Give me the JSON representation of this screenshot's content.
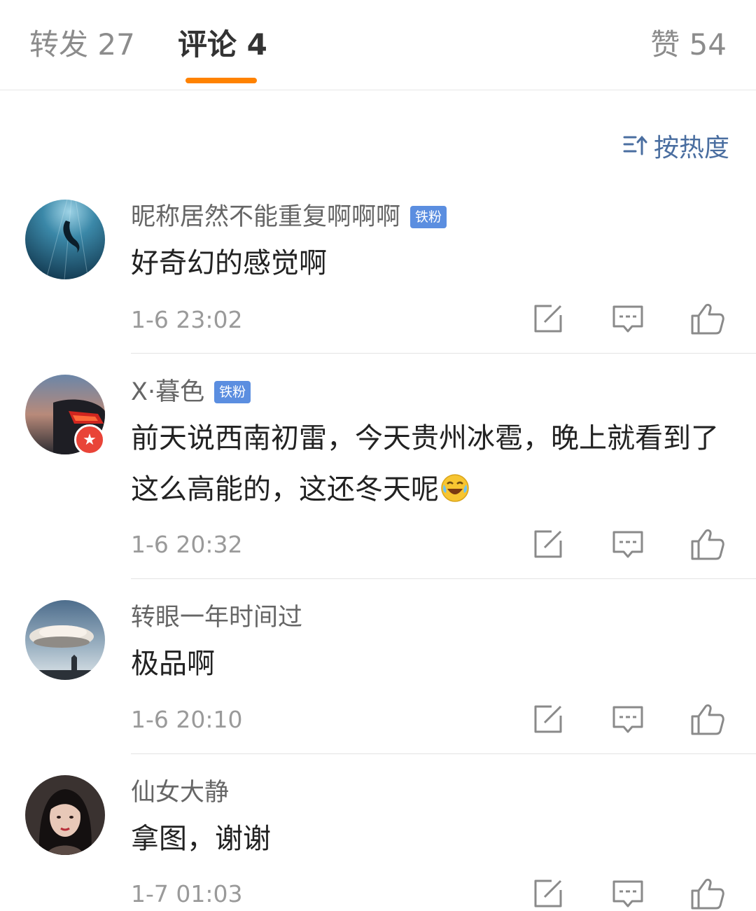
{
  "tabs": {
    "repost": "转发 27",
    "comment": "评论 4",
    "like": "赞 54"
  },
  "sort_label": "按热度",
  "colors": {
    "accent": "#ff8200",
    "link": "#4a6ea0",
    "badge": "#5b8ee0"
  },
  "comments": [
    {
      "name": "昵称居然不能重复啊啊啊",
      "badge": "铁粉",
      "text": "好奇幻的感觉啊",
      "time": "1-6 23:02"
    },
    {
      "name": "X·暮色",
      "badge": "铁粉",
      "text": "前天说西南初雷，今天贵州冰雹，晚上就看到了这么高能的，这还冬天呢",
      "emoji": "laughing-crying-emoji",
      "time": "1-6 20:32"
    },
    {
      "name": "转眼一年时间过",
      "text": "极品啊",
      "time": "1-6 20:10"
    },
    {
      "name": "仙女大静",
      "text": "拿图，谢谢",
      "time": "1-7 01:03"
    }
  ],
  "icons": [
    "sort-icon",
    "edit-icon",
    "reply-icon",
    "like-icon",
    "verified-star-icon"
  ]
}
